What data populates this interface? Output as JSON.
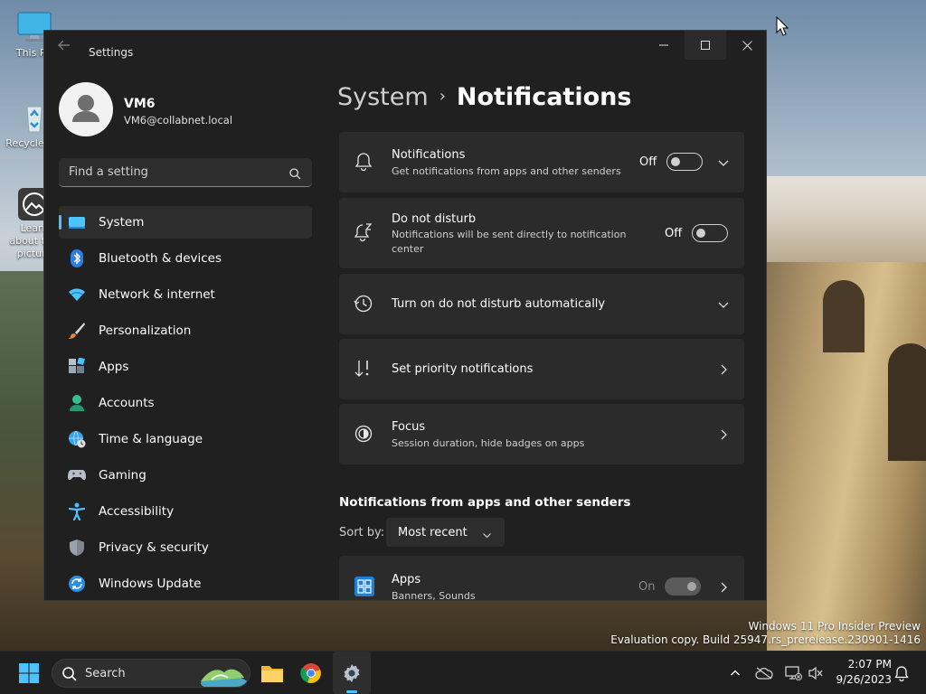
{
  "desktop": {
    "icons": [
      {
        "label": "This PC"
      },
      {
        "label": "Recycle Bin"
      },
      {
        "label": "Learn about this picture"
      }
    ],
    "watermark": {
      "line1": "Windows 11 Pro Insider Preview",
      "line2": "Evaluation copy. Build 25947.rs_prerelease.230901-1416"
    }
  },
  "window": {
    "title": "Settings",
    "controls": {
      "minimize": "minimize-icon",
      "maximize": "maximize-icon",
      "close": "close-icon"
    }
  },
  "profile": {
    "name": "VM6",
    "email": "VM6@collabnet.local"
  },
  "search": {
    "placeholder": "Find a setting",
    "value": ""
  },
  "sidebar": {
    "items": [
      {
        "label": "System",
        "icon": "system-icon",
        "active": true
      },
      {
        "label": "Bluetooth & devices",
        "icon": "bluetooth-icon"
      },
      {
        "label": "Network & internet",
        "icon": "wifi-icon"
      },
      {
        "label": "Personalization",
        "icon": "brush-icon"
      },
      {
        "label": "Apps",
        "icon": "apps-icon"
      },
      {
        "label": "Accounts",
        "icon": "accounts-icon"
      },
      {
        "label": "Time & language",
        "icon": "globe-clock-icon"
      },
      {
        "label": "Gaming",
        "icon": "gamepad-icon"
      },
      {
        "label": "Accessibility",
        "icon": "accessibility-icon"
      },
      {
        "label": "Privacy & security",
        "icon": "shield-icon"
      },
      {
        "label": "Windows Update",
        "icon": "update-icon"
      }
    ]
  },
  "breadcrumb": {
    "parent": "System",
    "separator": "›",
    "current": "Notifications"
  },
  "cards": {
    "notifications": {
      "title": "Notifications",
      "subtitle": "Get notifications from apps and other senders",
      "state": "Off"
    },
    "dnd": {
      "title": "Do not disturb",
      "subtitle": "Notifications will be sent directly to notification center",
      "state": "Off"
    },
    "auto_dnd": {
      "title": "Turn on do not disturb automatically"
    },
    "priority": {
      "title": "Set priority notifications"
    },
    "focus": {
      "title": "Focus",
      "subtitle": "Session duration, hide badges on apps"
    },
    "apps": {
      "title": "Apps",
      "subtitle": "Banners, Sounds",
      "state": "On"
    }
  },
  "apps_section": {
    "title": "Notifications from apps and other senders",
    "sort_label": "Sort by:",
    "sort_value": "Most recent"
  },
  "taskbar": {
    "search_label": "Search",
    "time": "2:07 PM",
    "date": "9/26/2023"
  },
  "colors": {
    "accent": "#4cc2ff",
    "window_bg": "#202020",
    "card_bg": "#2b2b2b"
  }
}
